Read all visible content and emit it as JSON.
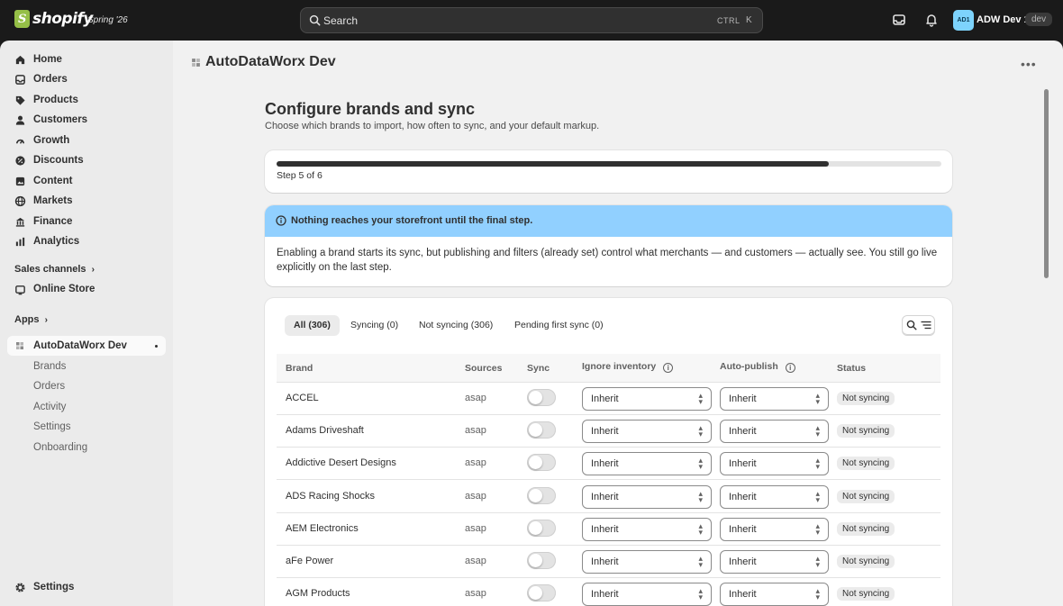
{
  "topbar": {
    "logo_text": "shopify",
    "release_label": "Spring '26",
    "search_placeholder": "Search",
    "shortcut_mod": "CTRL",
    "shortcut_key": "K",
    "avatar_initials": "AD1",
    "store_name": "ADW Dev 1",
    "env_badge": "dev"
  },
  "sidebar": {
    "items": [
      {
        "label": "Home",
        "icon": "home-icon"
      },
      {
        "label": "Orders",
        "icon": "orders-icon"
      },
      {
        "label": "Products",
        "icon": "products-icon"
      },
      {
        "label": "Customers",
        "icon": "customers-icon"
      },
      {
        "label": "Growth",
        "icon": "growth-icon"
      },
      {
        "label": "Discounts",
        "icon": "discounts-icon"
      },
      {
        "label": "Content",
        "icon": "content-icon"
      },
      {
        "label": "Markets",
        "icon": "markets-icon"
      },
      {
        "label": "Finance",
        "icon": "finance-icon"
      },
      {
        "label": "Analytics",
        "icon": "analytics-icon"
      }
    ],
    "sales_channels_label": "Sales channels",
    "online_store_label": "Online Store",
    "apps_label": "Apps",
    "app_name": "AutoDataWorx Dev",
    "app_subitems": [
      "Brands",
      "Orders",
      "Activity",
      "Settings",
      "Onboarding"
    ],
    "settings_label": "Settings"
  },
  "main": {
    "app_title": "AutoDataWorx Dev",
    "heading": "Configure brands and sync",
    "subheading": "Choose which brands to import, how often to sync, and your default markup.",
    "progress": {
      "fraction": 0.83,
      "step_text": "Step 5 of 6"
    },
    "banner": {
      "title": "Nothing reaches your storefront until the final step.",
      "body": "Enabling a brand starts its sync, but publishing and filters (already set) control what merchants — and customers — actually see. You still go live explicitly on the last step."
    },
    "tabs": [
      "All (306)",
      "Syncing (0)",
      "Not syncing (306)",
      "Pending first sync (0)"
    ],
    "table": {
      "columns": [
        "Brand",
        "Sources",
        "Sync",
        "Ignore inventory",
        "Auto-publish",
        "Status"
      ],
      "rows": [
        {
          "brand": "ACCEL",
          "source": "asap",
          "ignore_inventory": "Inherit",
          "auto_publish": "Inherit",
          "status": "Not syncing"
        },
        {
          "brand": "Adams Driveshaft",
          "source": "asap",
          "ignore_inventory": "Inherit",
          "auto_publish": "Inherit",
          "status": "Not syncing"
        },
        {
          "brand": "Addictive Desert Designs",
          "source": "asap",
          "ignore_inventory": "Inherit",
          "auto_publish": "Inherit",
          "status": "Not syncing"
        },
        {
          "brand": "ADS Racing Shocks",
          "source": "asap",
          "ignore_inventory": "Inherit",
          "auto_publish": "Inherit",
          "status": "Not syncing"
        },
        {
          "brand": "AEM Electronics",
          "source": "asap",
          "ignore_inventory": "Inherit",
          "auto_publish": "Inherit",
          "status": "Not syncing"
        },
        {
          "brand": "aFe Power",
          "source": "asap",
          "ignore_inventory": "Inherit",
          "auto_publish": "Inherit",
          "status": "Not syncing"
        },
        {
          "brand": "AGM Products",
          "source": "asap",
          "ignore_inventory": "Inherit",
          "auto_publish": "Inherit",
          "status": "Not syncing"
        }
      ]
    }
  },
  "colors": {
    "banner": "#91d0ff",
    "logo": "#95bf47",
    "avatar": "#7dd3fc"
  }
}
